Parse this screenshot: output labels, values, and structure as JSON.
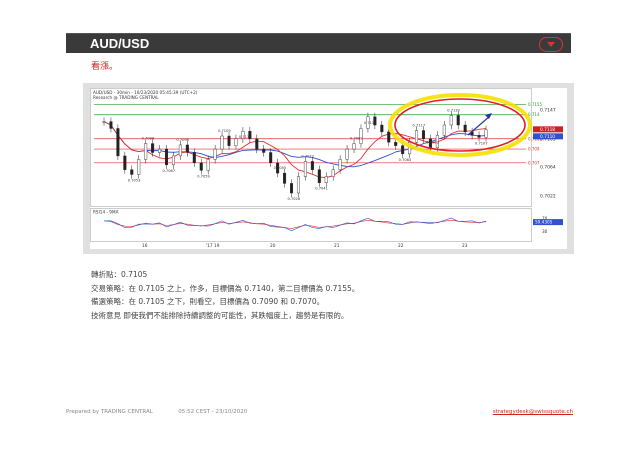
{
  "header": {
    "title": "AUD/USD"
  },
  "view_label": "看漲。",
  "chart": {
    "title_line": "AUD/USD - 30min - 10/23/2020 05:45:39 (UTC+2)",
    "research_line": "Research @ TRADING CENTRAL",
    "rsi_label": "RSI14 - 9MA",
    "price_axis": [
      "0.7147",
      "0.7105",
      "0.7064",
      "0.7022"
    ],
    "level_labels": [
      "0.7155",
      "0.714",
      "0.7105",
      "0.709",
      "0.707"
    ],
    "price_flags": [
      "0.7118",
      "0.7110"
    ],
    "rsi_axis": [
      "70",
      "30"
    ],
    "rsi_flags": [
      "59.4305"
    ],
    "x_labels": [
      "16",
      "'17 19",
      "20",
      "21",
      "22",
      "23"
    ],
    "annotations": [
      "0.7053",
      "0.7098",
      "0.7067",
      "0.7096",
      "0.7059",
      "0.7109",
      "0.7116",
      "0.7055",
      "0.7026",
      "0.7072",
      "0.7041",
      "0.7098",
      "0.7137",
      "0.7117",
      "0.7083",
      "0.7139",
      "0.7107",
      "0.7092"
    ],
    "colors": {
      "red_line": "#e03030",
      "green_line": "#2a9a2a",
      "blue_line": "#3050d0",
      "highlight": "#f5e000",
      "arrow": "#1a3aa0"
    }
  },
  "chart_data": {
    "type": "line",
    "title": "AUD/USD - 30min - 10/23/2020 05:45:39 (UTC+2)",
    "x": [
      "16",
      "'17 19",
      "20",
      "21",
      "22",
      "23"
    ],
    "ylim": [
      0.701,
      0.716
    ],
    "horizontal_levels": [
      {
        "value": 0.7155,
        "color": "green"
      },
      {
        "value": 0.714,
        "color": "green"
      },
      {
        "value": 0.7105,
        "color": "red"
      },
      {
        "value": 0.709,
        "color": "red"
      },
      {
        "value": 0.707,
        "color": "red"
      }
    ],
    "series": [
      {
        "name": "AUD/USD",
        "values": [
          0.713,
          0.712,
          0.708,
          0.706,
          0.7053,
          0.7075,
          0.7098,
          0.7085,
          0.709,
          0.7067,
          0.708,
          0.7096,
          0.7085,
          0.707,
          0.7059,
          0.7075,
          0.709,
          0.7109,
          0.7095,
          0.7105,
          0.7116,
          0.7105,
          0.709,
          0.7085,
          0.707,
          0.7055,
          0.704,
          0.7026,
          0.705,
          0.7072,
          0.706,
          0.7041,
          0.705,
          0.706,
          0.7075,
          0.709,
          0.7098,
          0.712,
          0.7137,
          0.7125,
          0.7115,
          0.71,
          0.7095,
          0.7083,
          0.71,
          0.7117,
          0.7105,
          0.7092,
          0.711,
          0.7125,
          0.7139,
          0.7125,
          0.7115,
          0.711,
          0.7107,
          0.7118
        ]
      }
    ],
    "rsi": {
      "label": "RSI14 - 9MA",
      "levels": [
        70,
        30
      ],
      "last": 59.4305
    }
  },
  "analysis": {
    "pivot": "轉折點：0.7105",
    "strategy": "交易策略：在 0.7105 之上，作多，目標價為 0.7140，第二目標價為 0.7155。",
    "alternative": "備選策略：在 0.7105 之下，則看空，目標價為 0.7090 和 0.7070。",
    "comment": "技術意見 即使我們不能排除持續調整的可能性，其跌幅度上，趨勢是有限的。"
  },
  "footer": {
    "prepared": "Prepared by TRADING CENTRAL",
    "timestamp": "05:52 CEST - 23/10/2020",
    "email": "strategydesk@swissquote.ch"
  }
}
